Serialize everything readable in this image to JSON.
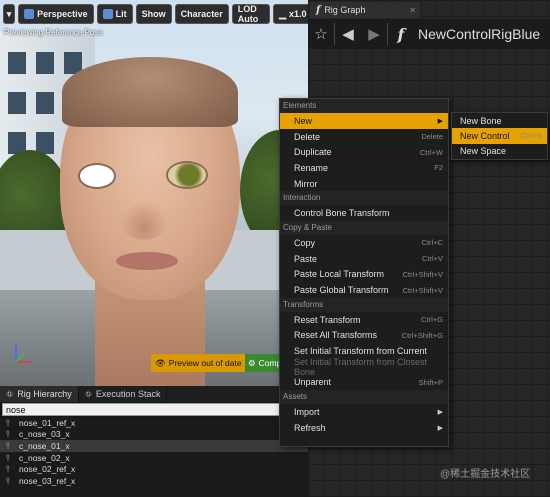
{
  "viewport": {
    "toolbar": {
      "perspective": "Perspective",
      "lit": "Lit",
      "show": "Show",
      "character": "Character",
      "lod": "LOD Auto",
      "speed": "x1.0"
    },
    "caption": "Previewing Reference Pose",
    "preview_badge": "Preview out of date",
    "compile_badge": "Comp"
  },
  "panel": {
    "tabs": [
      "Rig Hierarchy",
      "Execution Stack"
    ],
    "search_value": "nose",
    "items": [
      "nose_01_ref_x",
      "c_nose_03_x",
      "c_nose_01_x",
      "c_nose_02_x",
      "nose_02_ref_x",
      "nose_03_ref_x"
    ],
    "selected_index": 2
  },
  "graph": {
    "tab": "Rig Graph",
    "function_glyph": "f",
    "breadcrumb": "NewControlRigBlue"
  },
  "menu": {
    "sections": [
      {
        "title": "Elements",
        "items": [
          {
            "label": "New",
            "shortcut": "",
            "submenu": true,
            "highlighted": true
          },
          {
            "label": "Delete",
            "shortcut": "Delete"
          },
          {
            "label": "Duplicate",
            "shortcut": "Ctrl+W"
          },
          {
            "label": "Rename",
            "shortcut": "F2"
          },
          {
            "label": "Mirror",
            "shortcut": ""
          }
        ]
      },
      {
        "title": "Interaction",
        "items": [
          {
            "label": "Control Bone Transform",
            "shortcut": ""
          }
        ]
      },
      {
        "title": "Copy & Paste",
        "items": [
          {
            "label": "Copy",
            "shortcut": "Ctrl+C"
          },
          {
            "label": "Paste",
            "shortcut": "Ctrl+V"
          },
          {
            "label": "Paste Local Transform",
            "shortcut": "Ctrl+Shift+V"
          },
          {
            "label": "Paste Global Transform",
            "shortcut": "Ctrl+Shift+V"
          }
        ]
      },
      {
        "title": "Transforms",
        "items": [
          {
            "label": "Reset Transform",
            "shortcut": "Ctrl+G"
          },
          {
            "label": "Reset All Transforms",
            "shortcut": "Ctrl+Shift+G"
          },
          {
            "label": "Set Initial Transform from Current",
            "shortcut": ""
          },
          {
            "label": "Set Initial Transform from Closest Bone",
            "shortcut": "",
            "disabled": true
          },
          {
            "label": "Unparent",
            "shortcut": "Shift+P"
          }
        ]
      },
      {
        "title": "Assets",
        "items": [
          {
            "label": "Import",
            "shortcut": "",
            "submenu": true
          },
          {
            "label": "Refresh",
            "shortcut": "",
            "submenu": true
          }
        ]
      }
    ]
  },
  "submenu": {
    "items": [
      {
        "label": "New Bone",
        "shortcut": ""
      },
      {
        "label": "New Control",
        "shortcut": "Ctrl+N",
        "highlighted": true
      },
      {
        "label": "New Space",
        "shortcut": ""
      }
    ]
  },
  "watermark": "@稀土掘金技术社区",
  "colors": {
    "highlight": "#e5a200",
    "preview_badge": "#d89a00",
    "compile_badge": "#3a8a2e",
    "background": "#151515"
  }
}
